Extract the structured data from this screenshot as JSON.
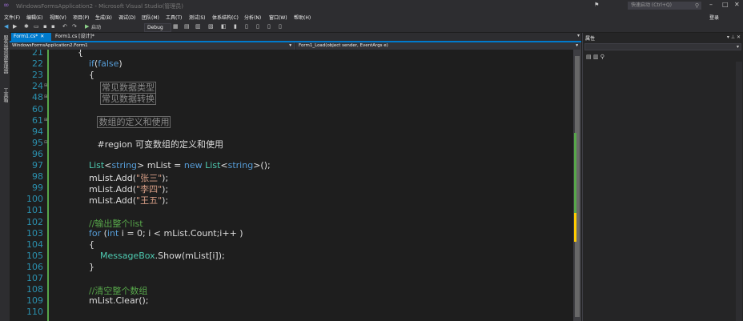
{
  "window": {
    "title": "WindowsFormsApplication2 - Microsoft Visual Studio(管理员)",
    "quick_launch_placeholder": "快速启动 (Ctrl+Q)",
    "login_label": "登录"
  },
  "menu": [
    "文件(F)",
    "编辑(E)",
    "视图(V)",
    "项目(P)",
    "生成(B)",
    "调试(D)",
    "团队(M)",
    "工具(T)",
    "测试(S)",
    "体系结构(C)",
    "分析(N)",
    "窗口(W)",
    "帮助(H)"
  ],
  "toolbar": {
    "start_label": "启动",
    "config_value": "Debug"
  },
  "left_strip": [
    "服务器资源管理器",
    "工具箱"
  ],
  "tabs": [
    {
      "label": "Form1.cs*",
      "active": true
    },
    {
      "label": "Form1.cs [设计]*",
      "active": false
    }
  ],
  "navbar": {
    "class_value": "WindowsFormsApplication2.Form1",
    "member_value": "Form1_Load(object sender, EventArgs e)"
  },
  "properties_panel": {
    "title": "属性"
  },
  "code_lines": [
    {
      "num": "21",
      "fold": "",
      "html": "<span class='pl'>{</span>"
    },
    {
      "num": "22",
      "fold": "",
      "html": "    <span class='kw'>if</span><span class='pl'>(</span><span class='kw'>false</span><span class='pl'>)</span>"
    },
    {
      "num": "23",
      "fold": "",
      "html": "    <span class='pl'>{</span>"
    },
    {
      "num": "24",
      "fold": "⊞",
      "html": "        <span class='reg'>常见数据类型</span>"
    },
    {
      "num": "48",
      "fold": "⊞",
      "html": "        <span class='reg'>常见数据转换</span>"
    },
    {
      "num": "60",
      "fold": "",
      "html": ""
    },
    {
      "num": "61",
      "fold": "⊞",
      "html": "       <span class='reg'>数组的定义和使用</span>"
    },
    {
      "num": "94",
      "fold": "",
      "html": ""
    },
    {
      "num": "95",
      "fold": "⊟",
      "html": "       <span class='pl'>#region 可变数组的定义和使用</span>"
    },
    {
      "num": "96",
      "fold": "",
      "html": ""
    },
    {
      "num": "97",
      "fold": "",
      "html": "    <span class='ty'>List</span><span class='pl'>&lt;</span><span class='kw'>string</span><span class='pl'>&gt; mList = </span><span class='kw'>new</span><span class='pl'> </span><span class='ty'>List</span><span class='pl'>&lt;</span><span class='kw'>string</span><span class='pl'>&gt;();</span>"
    },
    {
      "num": "98",
      "fold": "",
      "html": "    <span class='pl'>mList.Add(</span><span class='st'>\"张三\"</span><span class='pl'>);</span>"
    },
    {
      "num": "99",
      "fold": "",
      "html": "    <span class='pl'>mList.Add(</span><span class='st'>\"李四\"</span><span class='pl'>);</span>"
    },
    {
      "num": "100",
      "fold": "",
      "html": "    <span class='pl'>mList.Add(</span><span class='st'>\"王五\"</span><span class='pl'>);</span>"
    },
    {
      "num": "101",
      "fold": "",
      "html": ""
    },
    {
      "num": "102",
      "fold": "",
      "html": "    <span class='cm'>//输出整个list</span>"
    },
    {
      "num": "103",
      "fold": "",
      "html": "    <span class='kw'>for</span><span class='pl'> (</span><span class='kw'>int</span><span class='pl'> i = 0; i &lt; mList.Count;i++ )</span>"
    },
    {
      "num": "104",
      "fold": "",
      "html": "    <span class='pl'>{</span>"
    },
    {
      "num": "105",
      "fold": "",
      "html": "        <span class='ty'>MessageBox</span><span class='pl'>.Show(mList[i]);</span>"
    },
    {
      "num": "106",
      "fold": "",
      "html": "    <span class='pl'>}</span>"
    },
    {
      "num": "107",
      "fold": "",
      "html": ""
    },
    {
      "num": "108",
      "fold": "",
      "html": "    <span class='cm'>//清空整个数组</span>"
    },
    {
      "num": "109",
      "fold": "",
      "html": "    <span class='pl'>mList.Clear();</span>"
    },
    {
      "num": "110",
      "fold": "",
      "html": ""
    }
  ],
  "colors": {
    "accent": "#007acc",
    "keyword": "#569cd6",
    "type": "#4ec9b0",
    "string": "#d69d85",
    "comment": "#57a64a",
    "line_number": "#2b91af"
  },
  "icons": [
    "vs-logo-icon",
    "flag-icon",
    "minimize-icon",
    "maximize-icon",
    "close-icon",
    "search-icon",
    "back-icon",
    "forward-icon",
    "new-project-icon",
    "open-icon",
    "save-icon",
    "save-all-icon",
    "undo-icon",
    "redo-icon",
    "start-icon",
    "pin-icon",
    "categorized-icon",
    "alphabetical-icon",
    "property-pages-icon"
  ]
}
